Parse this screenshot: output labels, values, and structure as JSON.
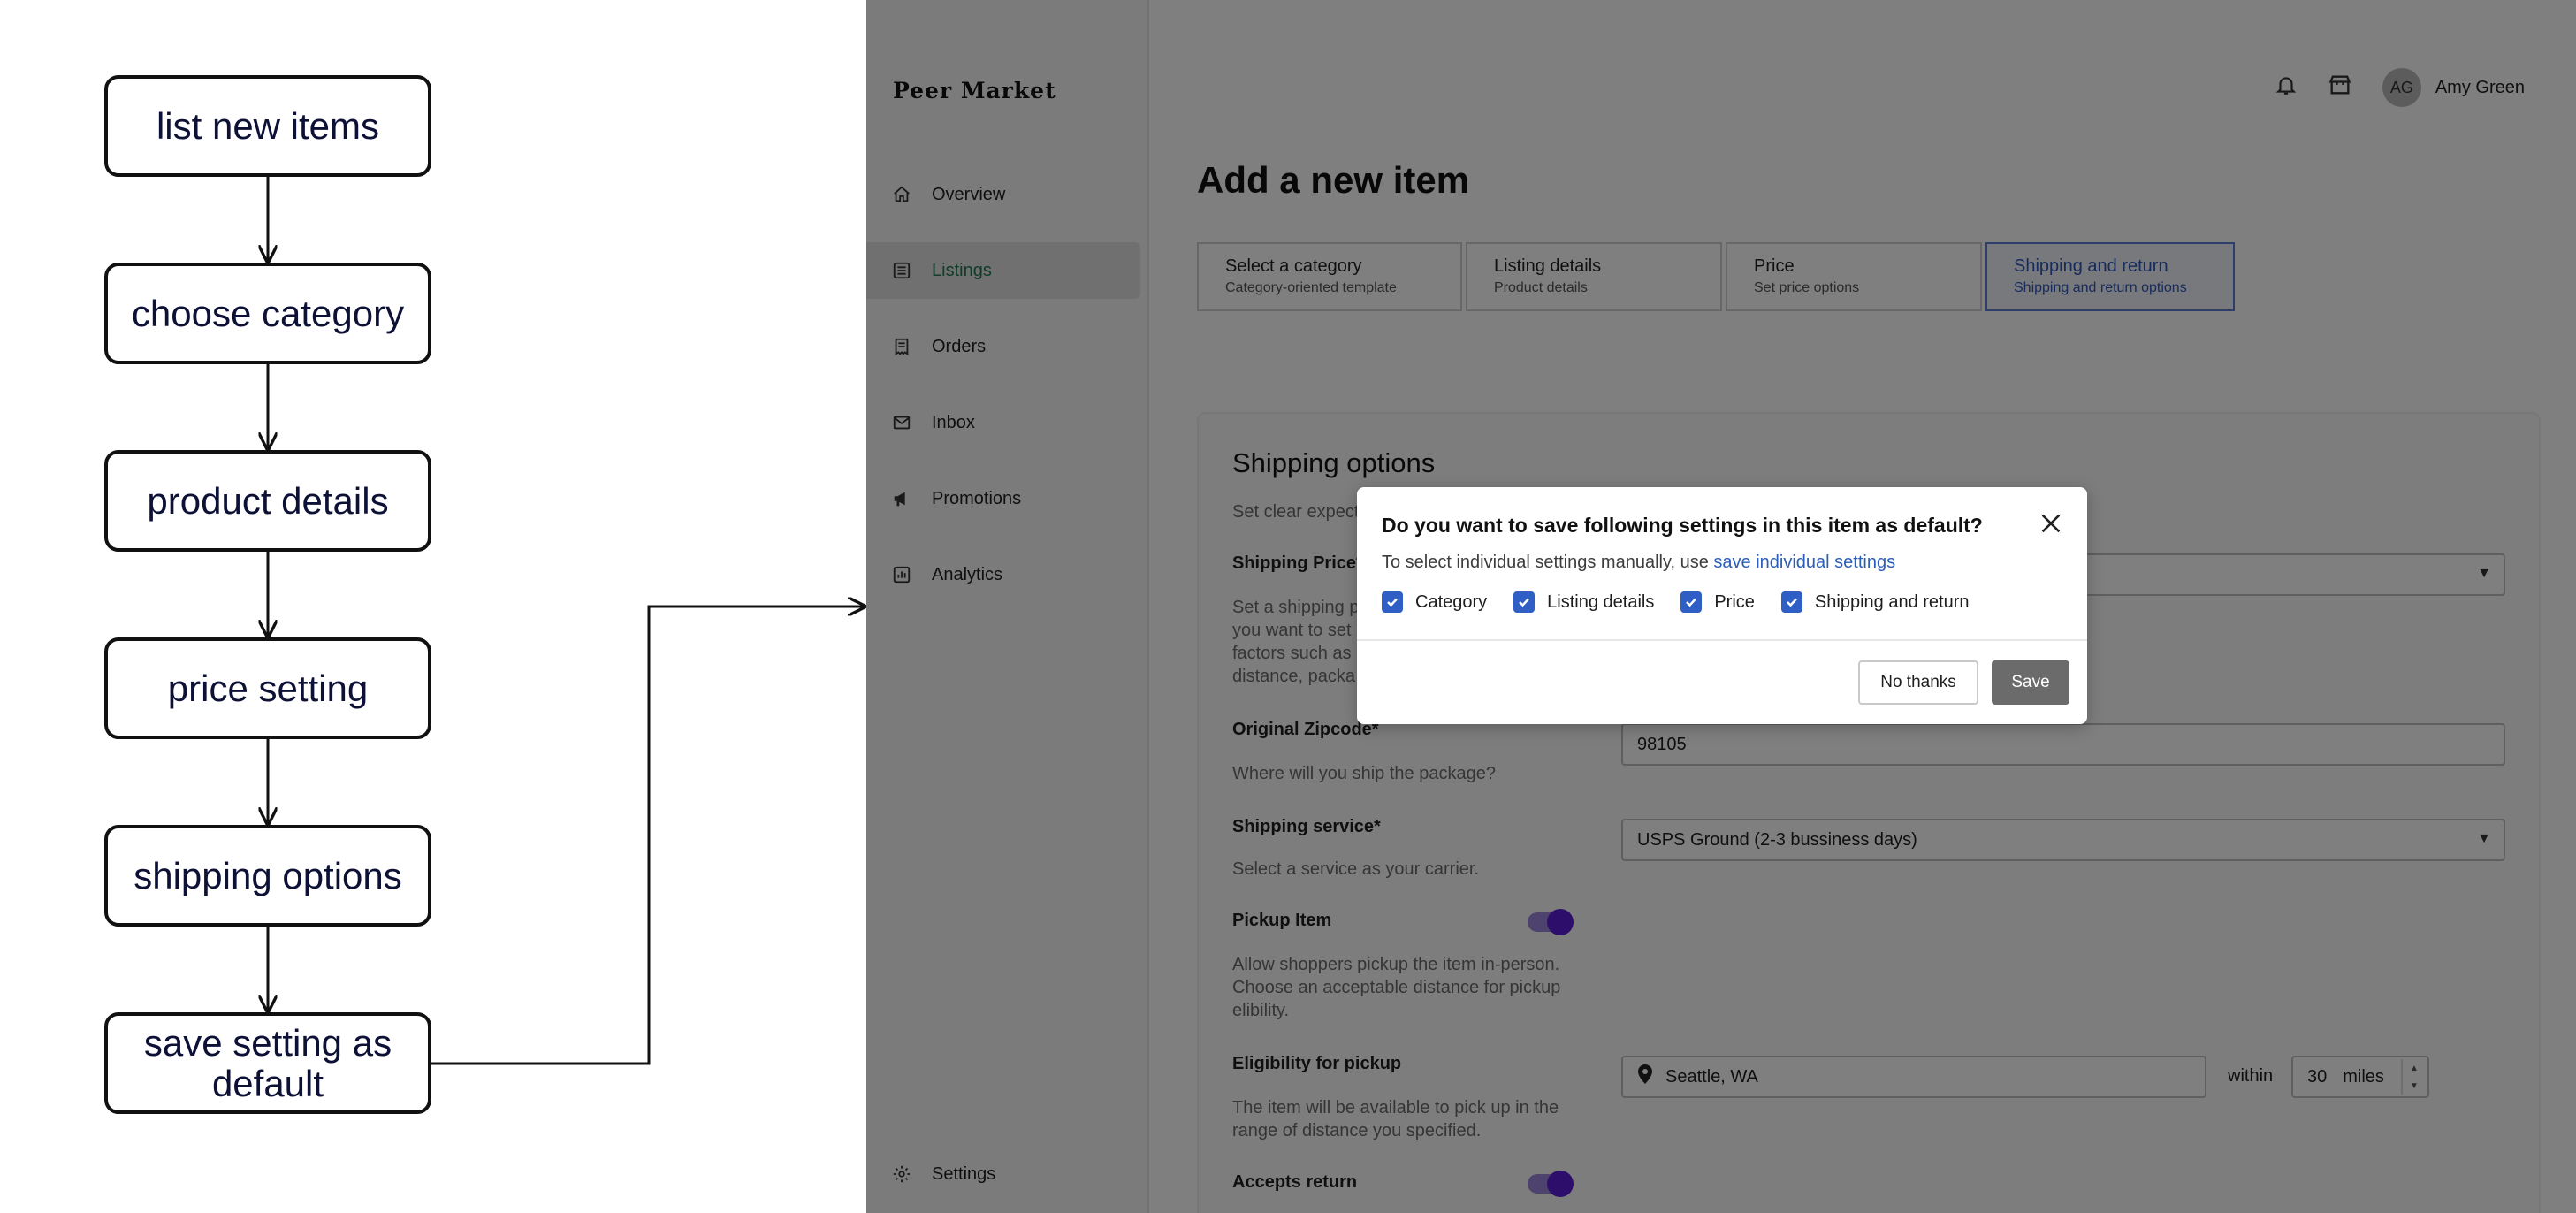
{
  "flowchart": {
    "steps": [
      "list new items",
      "choose category",
      "product details",
      "price setting",
      "shipping options",
      "save setting as default"
    ]
  },
  "app": {
    "logo": "Peer Market",
    "nav": [
      {
        "label": "Overview",
        "icon": "home-icon"
      },
      {
        "label": "Listings",
        "icon": "listings-icon",
        "active": true
      },
      {
        "label": "Orders",
        "icon": "orders-icon"
      },
      {
        "label": "Inbox",
        "icon": "inbox-icon"
      },
      {
        "label": "Promotions",
        "icon": "megaphone-icon"
      },
      {
        "label": "Analytics",
        "icon": "analytics-icon"
      }
    ],
    "settings_label": "Settings",
    "user": {
      "initials": "AG",
      "name": "Amy Green"
    },
    "page_title": "Add a new item",
    "steps": [
      {
        "title": "Select a category",
        "subtitle": "Category-oriented template"
      },
      {
        "title": "Listing details",
        "subtitle": "Product details"
      },
      {
        "title": "Price",
        "subtitle": "Set price options"
      },
      {
        "title": "Shipping and return",
        "subtitle": "Shipping and return options",
        "current": true
      }
    ],
    "form": {
      "section_title": "Shipping options",
      "section_hint": "Set clear expect",
      "shipping_price_label": "Shipping Price*",
      "shipping_price_hint": "Set a shipping p\nyou want to set\nfactors such as\ndistance, packa",
      "zipcode_label": "Original Zipcode*",
      "zipcode_hint": "Where will you ship the package?",
      "zipcode_value": "98105",
      "service_label": "Shipping service*",
      "service_hint": "Select a service as your carrier.",
      "service_value": "USPS Ground (2-3 bussiness days)",
      "pickup_label": "Pickup Item",
      "pickup_hint": "Allow shoppers pickup the item in-person.\nChoose an acceptable distance for pickup\nelibility.",
      "pickup_on": true,
      "eligibility_label": "Eligibility for pickup",
      "eligibility_hint": "The item will be available to pick up in the\nrange of distance you specified.",
      "location_value": "Seattle, WA",
      "within_label": "within",
      "miles_value": "30",
      "miles_unit": "miles",
      "returns_label": "Accepts return",
      "returns_on": true
    },
    "dialog": {
      "title": "Do you want to save following settings in this item as default?",
      "subtitle": "To select individual settings manually, use",
      "link": "save individual settings",
      "checks": [
        {
          "label": "Category",
          "checked": true
        },
        {
          "label": "Listing details",
          "checked": true
        },
        {
          "label": "Price",
          "checked": true
        },
        {
          "label": "Shipping and return",
          "checked": true
        }
      ],
      "no_thanks": "No thanks",
      "save": "Save"
    }
  },
  "colors": {
    "accent_green": "#1f7a52",
    "checkbox_blue": "#2f5fc4",
    "toggle_purple": "#5b1fd6",
    "link_blue": "#2b5eb8"
  }
}
